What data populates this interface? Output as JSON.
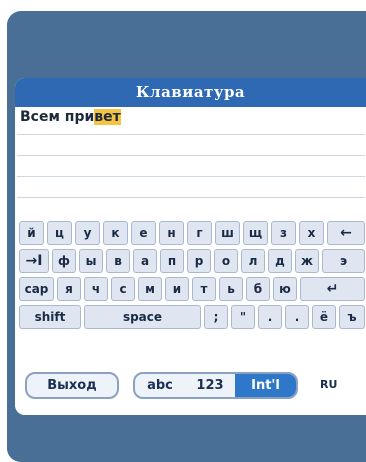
{
  "title": "Клавиатура",
  "text_area": {
    "prefix": "Всем при",
    "highlight": "вет"
  },
  "keyboard": {
    "row1": [
      "й",
      "ц",
      "у",
      "к",
      "е",
      "н",
      "г",
      "ш",
      "щ",
      "з",
      "х",
      "←"
    ],
    "row2": [
      "→I",
      "ф",
      "ы",
      "в",
      "а",
      "п",
      "р",
      "о",
      "л",
      "д",
      "ж",
      "э"
    ],
    "row3": [
      "cap",
      "я",
      "ч",
      "с",
      "м",
      "и",
      "т",
      "ь",
      "б",
      "ю",
      "↵"
    ],
    "row4": [
      "shift",
      "space",
      ";",
      "\"",
      ".",
      ".",
      "ё",
      "ъ"
    ]
  },
  "bottom": {
    "exit_label": "Выход",
    "mode_abc": "abc",
    "mode_123": "123",
    "mode_intl": "Int'l",
    "lang": "RU"
  },
  "colors": {
    "frame": "#4a6f96",
    "title_bar": "#2f68b3",
    "highlight": "#f5c542",
    "active_mode": "#2f78c9"
  }
}
